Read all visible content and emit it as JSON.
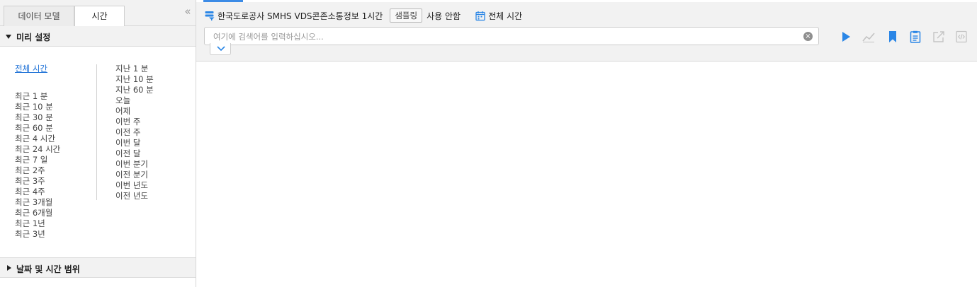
{
  "tabs": {
    "data_model": "데이터 모델",
    "time": "시간"
  },
  "presets": {
    "title": "미리 설정",
    "all_time": "전체 시간",
    "recent": [
      "최근 1 분",
      "최근 10 분",
      "최근 30 분",
      "최근 60 분",
      "최근 4 시간",
      "최근 24 시간",
      "최근 7 일",
      "최근 2주",
      "최근 3주",
      "최근 4주",
      "최근 3개월",
      "최근 6개월",
      "최근 1년",
      "최근 3년"
    ],
    "relative": [
      "지난 1 분",
      "지난 10 분",
      "지난 60 분",
      "오늘",
      "어제",
      "이번 주",
      "이전 주",
      "이번 달",
      "이전 달",
      "이번 분기",
      "이전 분기",
      "이번 년도",
      "이전 년도"
    ]
  },
  "date_range": {
    "title": "날짜 및 시간 범위"
  },
  "query": {
    "datasource": "한국도로공사 SMHS VDS콘존소통정보 1시간",
    "sampling_label": "샘플링",
    "sampling_value": "사용 안함",
    "time_range": "전체 시간",
    "search_placeholder": "여기에 검색어를 입력하십시오..."
  },
  "icons": {
    "collapse": "double-chevron-left-icon",
    "datasource": "datasource-icon",
    "calendar": "calendar-icon",
    "clear": "clear-icon",
    "expand": "chevron-down-icon",
    "run": "play-icon",
    "chart": "line-chart-icon",
    "bookmark": "bookmark-icon",
    "report": "report-icon",
    "export": "export-icon",
    "code": "code-icon"
  },
  "colors": {
    "accent": "#1a6fd6",
    "icon_active": "#2a86e6",
    "icon_disabled": "#c4c4c4"
  }
}
